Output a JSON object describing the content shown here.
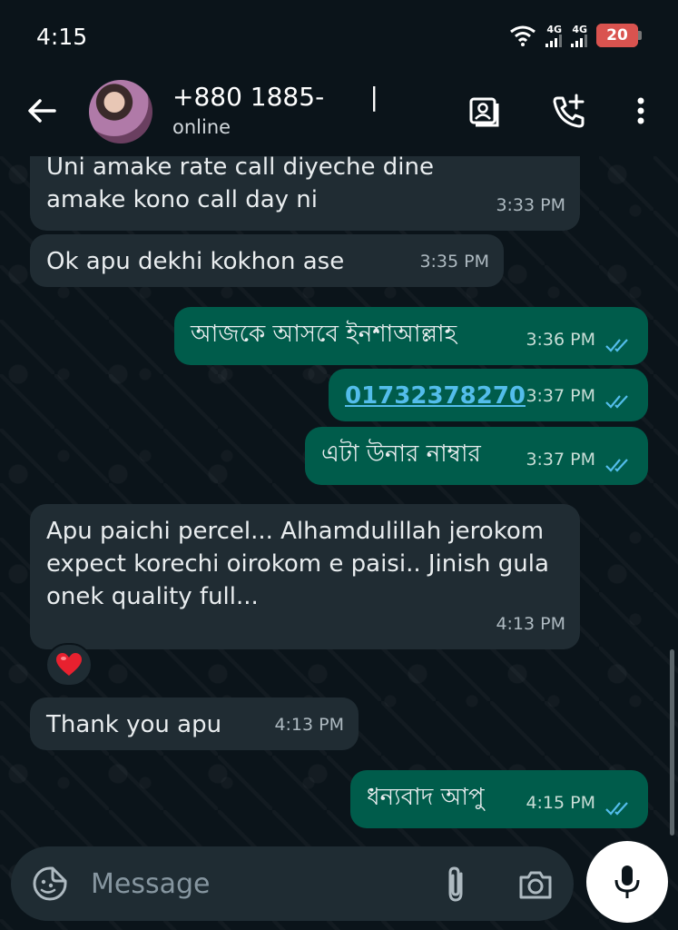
{
  "status_bar": {
    "time": "4:15",
    "signal1_label": "4G",
    "signal2_label": "4G",
    "battery": "20"
  },
  "header": {
    "contact_name": "+880 1885-         |",
    "status": "online"
  },
  "messages": [
    {
      "dir": "in",
      "text": "Uni amake rate call diyeche dine amake kono call day ni",
      "time": "3:33 PM"
    },
    {
      "dir": "in",
      "text": "Ok apu dekhi kokhon ase",
      "time": "3:35 PM"
    },
    {
      "dir": "out",
      "text": "আজকে আসবে ইনশাআল্লাহ",
      "time": "3:36 PM"
    },
    {
      "dir": "out",
      "text": "01732378270",
      "time": "3:37 PM",
      "link": true
    },
    {
      "dir": "out",
      "text": "এটা উনার নাম্বার",
      "time": "3:37 PM"
    },
    {
      "dir": "in",
      "text": "Apu paichi percel...  Alhamdulillah jerokom expect korechi oirokom e paisi..  Jinish gula onek quality full...",
      "time": "4:13 PM"
    },
    {
      "dir": "in",
      "text": "Thank you apu",
      "time": "4:13 PM"
    },
    {
      "dir": "out",
      "text": "ধন্যবাদ আপু",
      "time": "4:15 PM"
    }
  ],
  "reaction": "heart-emoji",
  "input": {
    "placeholder": "Message"
  },
  "colors": {
    "background": "#0b141a",
    "incoming": "#202c33",
    "outgoing": "#005c4b",
    "read_ticks": "#53bdeb"
  }
}
